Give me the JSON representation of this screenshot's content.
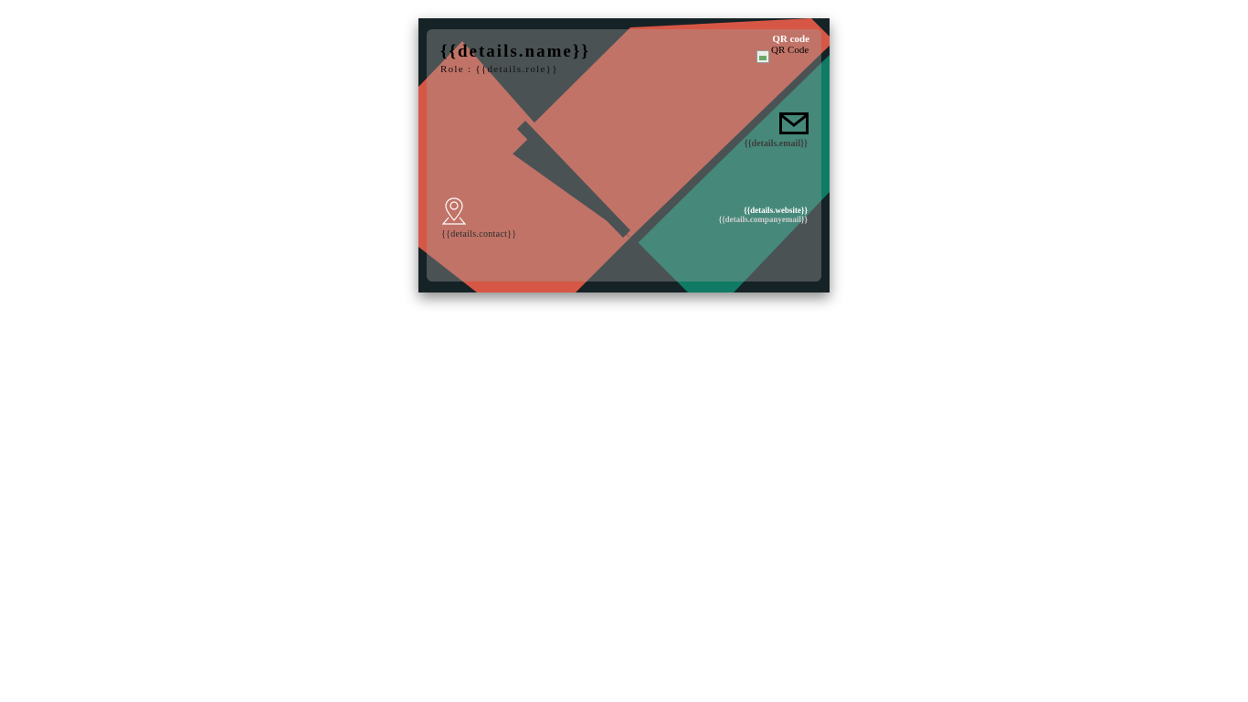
{
  "card": {
    "name": "{{details.name}}",
    "role_label": "Role",
    "role_separator": ":",
    "role_value": "{{details.role}}",
    "qr_label": "QR code",
    "qr_alt": "QR Code",
    "email": "{{details.email}}",
    "website": "{{details.website}}",
    "company_email": "{{details.companyemail}}",
    "contact": "{{details.contact}}",
    "icons": {
      "mail": "mail-icon",
      "location": "location-pin-icon",
      "qr": "broken-image-icon"
    }
  },
  "colors": {
    "background_dark": "#152226",
    "coral": "#d65745",
    "teal": "#0f7b64",
    "overlay": "rgba(160,160,160,0.38)"
  }
}
